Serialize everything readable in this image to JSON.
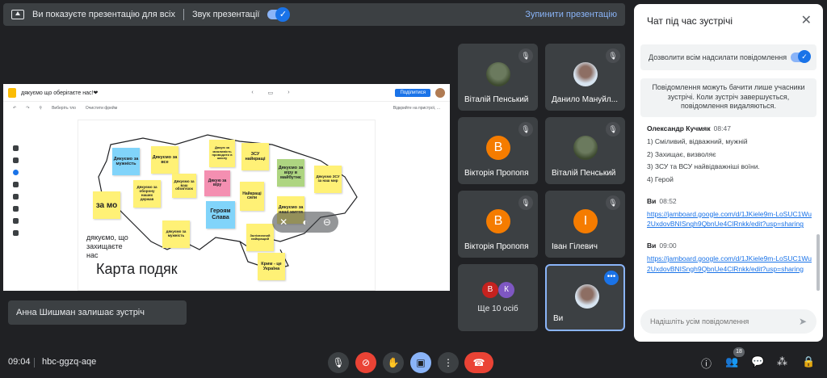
{
  "banner": {
    "presenting_text": "Ви показуєте презентацію для всіх",
    "sound_label": "Звук презентації",
    "stop_label": "Зупинити презентацію"
  },
  "jamboard": {
    "title": "дякуємо що оберігаєте нас!❤",
    "share_label": "Поділитися",
    "toolbar": [
      "Виберіть тло",
      "Очистити фрейм"
    ],
    "toolbar_right": "Відкрийте на пристрої, ...",
    "canvas_title": "Карта подяк",
    "handwritten": "дякуємо, що захищаєте нас",
    "notes": [
      "Дякуємо за мужність",
      "Дякуємо за все",
      "Дякуємо за оборону наших держав",
      "Дякуємо за ваш обов'язок",
      "Дякую за можливість проводити в школу",
      "ЗСУ найкращі",
      "Дякуємо за віру в майбутнє",
      "Дякуємо ЗСУ за наш мир",
      "Дякую за віру",
      "Найкращі сили",
      "Героям Слава",
      "Дякуємо за наші життя",
      "за мо",
      "дякуємо за мужність",
      "Залізничний найкращий",
      "Крим - це Україна"
    ]
  },
  "participants": [
    {
      "name": "Віталій Пенський",
      "avatar_type": "photo"
    },
    {
      "name": "Данило Мануйл...",
      "avatar_type": "photo"
    },
    {
      "name": "Вікторія Пропопя",
      "initial": "В",
      "color": "#f57c00"
    },
    {
      "name": "Віталій Пенський",
      "avatar_type": "photo"
    },
    {
      "name": "Вікторія Пропопя",
      "initial": "В",
      "color": "#f57c00"
    },
    {
      "name": "Іван Гілевич",
      "initial": "І",
      "color": "#f57c00"
    }
  ],
  "more_tile": {
    "label": "Ще 10 осіб",
    "initials": [
      "В",
      "К"
    ]
  },
  "self_tile": {
    "name": "Ви"
  },
  "toast": "Анна Шишман залишає зустріч",
  "chat": {
    "title": "Чат під час зустрічі",
    "allow_label": "Дозволити всім надсилати повідомлення",
    "notice": "Повідомлення можуть бачити лише учасники зустрічі. Коли зустріч завершується, повідомлення видаляються.",
    "messages": [
      {
        "sender": "Олександр Кучмяк",
        "time": "08:47",
        "lines": [
          "1) Сміливий, відважний, мужній",
          "2) Захищає, визволяє",
          "3) ЗСУ та ВСУ найвідважніші воїни.",
          "4) Герой"
        ]
      },
      {
        "sender": "Ви",
        "time": "08:52",
        "link": "https://jamboard.google.com/d/1JKiele9m-LoSUC1Wu2UxdovBNISngh9QbnUe4ClRnkk/edit?usp=sharing"
      },
      {
        "sender": "Ви",
        "time": "09:00",
        "link": "https://jamboard.google.com/d/1JKiele9m-LoSUC1Wu2UxdovBNISngh9QbnUe4ClRnkk/edit?usp=sharing"
      }
    ],
    "input_placeholder": "Надішліть усім повідомлення"
  },
  "bottom": {
    "time": "09:04",
    "meeting_code": "hbc-ggzq-aqe",
    "participants_count": "18"
  }
}
